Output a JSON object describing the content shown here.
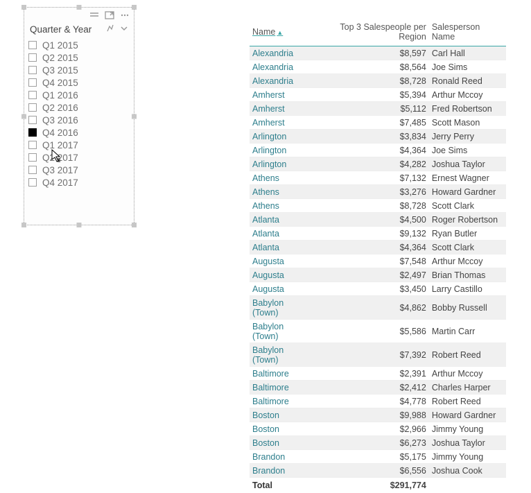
{
  "slicer": {
    "title": "Quarter & Year",
    "items": [
      {
        "label": "Q1 2015",
        "checked": false
      },
      {
        "label": "Q2 2015",
        "checked": false
      },
      {
        "label": "Q3 2015",
        "checked": false
      },
      {
        "label": "Q4 2015",
        "checked": false
      },
      {
        "label": "Q1 2016",
        "checked": false
      },
      {
        "label": "Q2 2016",
        "checked": false
      },
      {
        "label": "Q3 2016",
        "checked": false
      },
      {
        "label": "Q4 2016",
        "checked": true
      },
      {
        "label": "Q1 2017",
        "checked": false
      },
      {
        "label": "Q2 2017",
        "checked": false
      },
      {
        "label": "Q3 2017",
        "checked": false
      },
      {
        "label": "Q4 2017",
        "checked": false
      }
    ]
  },
  "table": {
    "columns": {
      "name": "Name",
      "metric": "Top 3 Salespeople per Region",
      "person": "Salesperson Name"
    },
    "rows": [
      {
        "name": "Alexandria",
        "metric": "$8,597",
        "person": "Carl Hall"
      },
      {
        "name": "Alexandria",
        "metric": "$8,564",
        "person": "Joe Sims"
      },
      {
        "name": "Alexandria",
        "metric": "$8,728",
        "person": "Ronald Reed"
      },
      {
        "name": "Amherst",
        "metric": "$5,394",
        "person": "Arthur Mccoy"
      },
      {
        "name": "Amherst",
        "metric": "$5,112",
        "person": "Fred Robertson"
      },
      {
        "name": "Amherst",
        "metric": "$7,485",
        "person": "Scott Mason"
      },
      {
        "name": "Arlington",
        "metric": "$3,834",
        "person": "Jerry Perry"
      },
      {
        "name": "Arlington",
        "metric": "$4,364",
        "person": "Joe Sims"
      },
      {
        "name": "Arlington",
        "metric": "$4,282",
        "person": "Joshua Taylor"
      },
      {
        "name": "Athens",
        "metric": "$7,132",
        "person": "Ernest Wagner"
      },
      {
        "name": "Athens",
        "metric": "$3,276",
        "person": "Howard Gardner"
      },
      {
        "name": "Athens",
        "metric": "$8,728",
        "person": "Scott Clark"
      },
      {
        "name": "Atlanta",
        "metric": "$4,500",
        "person": "Roger Robertson"
      },
      {
        "name": "Atlanta",
        "metric": "$9,132",
        "person": "Ryan Butler"
      },
      {
        "name": "Atlanta",
        "metric": "$4,364",
        "person": "Scott Clark"
      },
      {
        "name": "Augusta",
        "metric": "$7,548",
        "person": "Arthur Mccoy"
      },
      {
        "name": "Augusta",
        "metric": "$2,497",
        "person": "Brian Thomas"
      },
      {
        "name": "Augusta",
        "metric": "$3,450",
        "person": "Larry Castillo"
      },
      {
        "name": "Babylon (Town)",
        "metric": "$4,862",
        "person": "Bobby Russell"
      },
      {
        "name": "Babylon (Town)",
        "metric": "$5,586",
        "person": "Martin Carr"
      },
      {
        "name": "Babylon (Town)",
        "metric": "$7,392",
        "person": "Robert Reed"
      },
      {
        "name": "Baltimore",
        "metric": "$2,391",
        "person": "Arthur Mccoy"
      },
      {
        "name": "Baltimore",
        "metric": "$2,412",
        "person": "Charles Harper"
      },
      {
        "name": "Baltimore",
        "metric": "$4,778",
        "person": "Robert Reed"
      },
      {
        "name": "Boston",
        "metric": "$9,988",
        "person": "Howard Gardner"
      },
      {
        "name": "Boston",
        "metric": "$2,966",
        "person": "Jimmy Young"
      },
      {
        "name": "Boston",
        "metric": "$6,273",
        "person": "Joshua Taylor"
      },
      {
        "name": "Brandon",
        "metric": "$5,175",
        "person": "Jimmy Young"
      },
      {
        "name": "Brandon",
        "metric": "$6,556",
        "person": "Joshua Cook"
      }
    ],
    "total": {
      "label": "Total",
      "value": "$291,774"
    }
  }
}
